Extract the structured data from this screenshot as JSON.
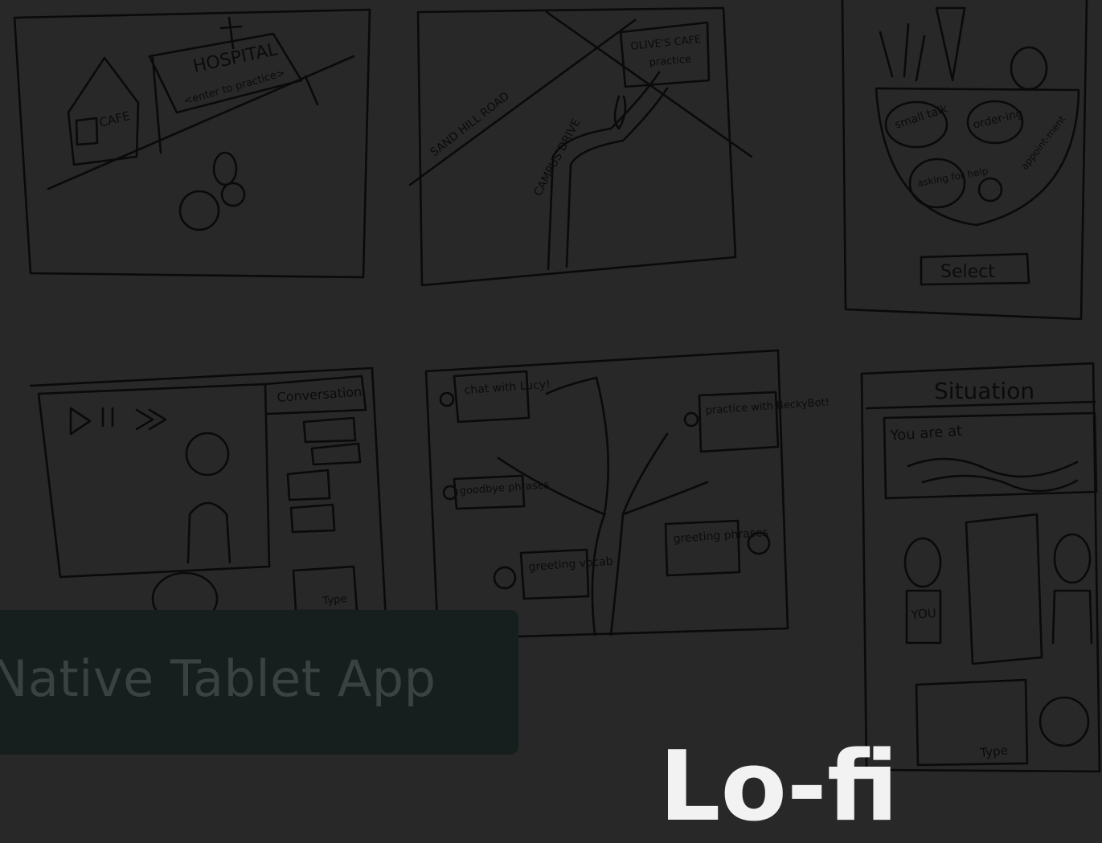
{
  "caption": {
    "title": "Native Tablet App"
  },
  "overlay_heading": "Lo-fi",
  "sketches": {
    "hospital": {
      "hospital_sign": "HOSPITAL",
      "enter_label": "<enter to practice>",
      "cafe": "CAFE"
    },
    "map": {
      "road1": "SAND HILL ROAD",
      "road2": "CAMPUS DRIVE",
      "place": "OLIVE'S CAFE",
      "practice": "practice"
    },
    "bowl": {
      "topic1": "small talk",
      "topic2": "order-ing",
      "topic3": "asking for help",
      "topic4": "appoint-ment",
      "select": "Select"
    },
    "conversation": {
      "panel_title": "Conversation",
      "type": "Type"
    },
    "tree": {
      "n1": "chat with Lucy!",
      "n2": "practice with BeckyBot!",
      "n3": "goodbye phrases",
      "n4": "greeting phrases",
      "n5": "greeting vocab"
    },
    "situation": {
      "title": "Situation",
      "line": "You are at",
      "you": "YOU",
      "type": "Type"
    }
  }
}
